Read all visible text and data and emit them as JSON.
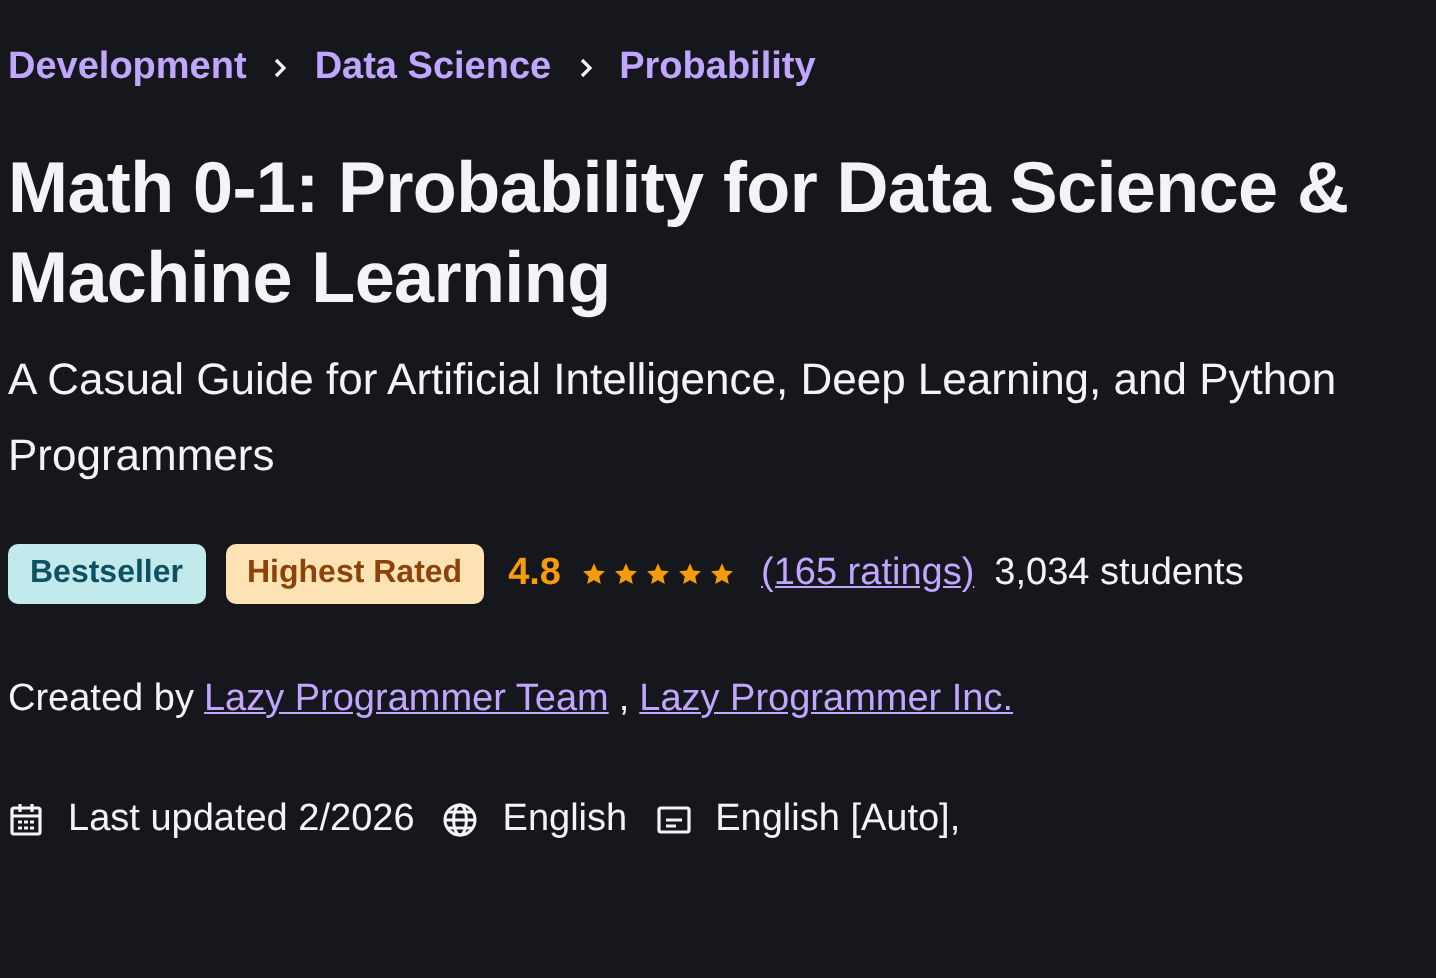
{
  "breadcrumbs": [
    "Development",
    "Data Science",
    "Probability"
  ],
  "title": "Math 0-1: Probability for Data Science & Machine Learning",
  "subtitle": "A Casual Guide for Artificial Intelligence, Deep Learning, and Python Programmers",
  "badges": [
    {
      "label": "Bestseller",
      "kind": "bestseller"
    },
    {
      "label": "Highest Rated",
      "kind": "highest-rated"
    }
  ],
  "rating": {
    "value": "4.8",
    "stars": 5,
    "count": "(165 ratings)",
    "students": "3,034 students"
  },
  "created_by": {
    "label": "Created by",
    "authors": [
      "Lazy Programmer Team",
      "Lazy Programmer Inc."
    ],
    "separator": ","
  },
  "meta": [
    {
      "kind": "updated",
      "text": "Last updated 2/2026"
    },
    {
      "kind": "language",
      "text": "English"
    },
    {
      "kind": "captions",
      "text": "English [Auto],"
    }
  ]
}
